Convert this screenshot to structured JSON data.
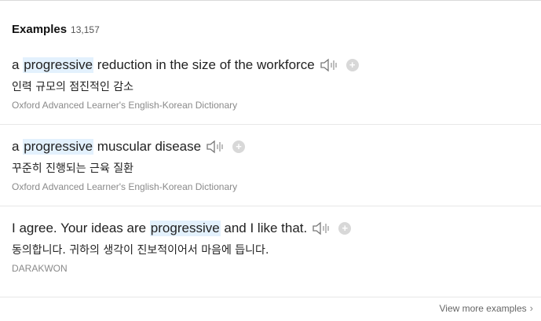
{
  "header": {
    "title": "Examples",
    "count": "13,157"
  },
  "examples": [
    {
      "pre": "a ",
      "highlight": "progressive",
      "post": " reduction in the size of the workforce",
      "ko": "인력 규모의 점진적인 감소",
      "source": "Oxford Advanced Learner's English-Korean Dictionary"
    },
    {
      "pre": "a ",
      "highlight": "progressive",
      "post": " muscular disease",
      "ko": "꾸준히 진행되는 근육 질환",
      "source": "Oxford Advanced Learner's English-Korean Dictionary"
    },
    {
      "pre": "I agree. Your ideas are ",
      "highlight": "progressive",
      "post": " and I like that.",
      "ko": "동의합니다. 귀하의 생각이 진보적이어서 마음에 듭니다.",
      "source": "DARAKWON"
    }
  ],
  "footer": {
    "view_more_label": "View more examples"
  },
  "icons": {
    "speaker": "speaker-icon",
    "add": "plus-circle-icon",
    "chevron": "chevron-right-icon"
  },
  "colors": {
    "highlight": "#e3f1fd",
    "source_text": "#8a8a8a"
  }
}
